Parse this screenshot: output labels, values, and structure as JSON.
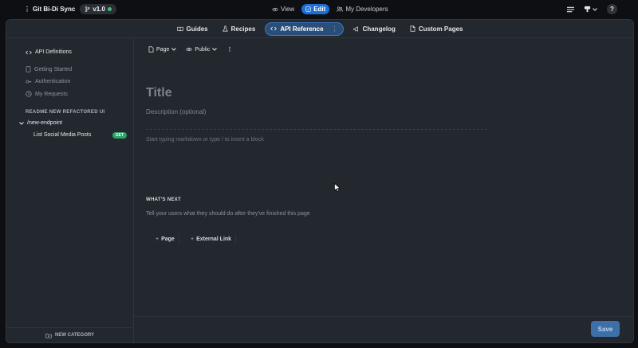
{
  "topbar": {
    "project_name": "Git Bi-Di Sync",
    "version": "v1.0",
    "modes": [
      {
        "label": "View",
        "icon": "eye-icon"
      },
      {
        "label": "Edit",
        "icon": "edit-icon"
      },
      {
        "label": "My Developers",
        "icon": "users-icon"
      }
    ],
    "help_label": "?"
  },
  "nav": {
    "items": [
      {
        "label": "Guides",
        "icon": "book-icon"
      },
      {
        "label": "Recipes",
        "icon": "flask-icon"
      },
      {
        "label": "API Reference",
        "icon": "code-icon"
      },
      {
        "label": "Changelog",
        "icon": "megaphone-icon"
      },
      {
        "label": "Custom Pages",
        "icon": "file-icon"
      }
    ],
    "active": "API Reference",
    "more_label": "⋮"
  },
  "sidebar": {
    "api_definitions": "API Definitions",
    "links": [
      "Getting Started",
      "Authentication",
      "My Requests"
    ],
    "section_title": "README NEW REFACTORED UI",
    "endpoint": "/new-endpoint",
    "endpoint_child": "List Social Media Posts",
    "method_badge": "GET",
    "new_category": "NEW CATEGORY"
  },
  "editor": {
    "type_select": "Page",
    "visibility_select": "Public",
    "title_placeholder": "Title",
    "description_placeholder": "Description (optional)",
    "body_placeholder": "Start typing markdown or type / to insert a block",
    "whats_next_label": "WHAT'S NEXT",
    "whats_next_desc": "Tell your users what they should do after they've finished this page",
    "add_page": "Page",
    "add_external_link": "External Link",
    "save_label": "Save"
  },
  "colors": {
    "accent": "#1d6fd8",
    "get_badge": "#2ea368",
    "panel_bg": "#23282e",
    "page_bg": "#0d0f12"
  }
}
